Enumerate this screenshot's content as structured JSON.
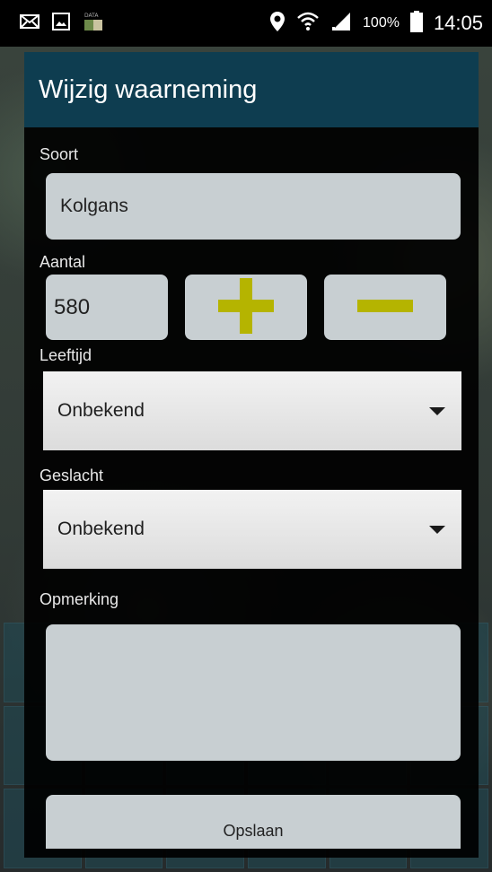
{
  "status_bar": {
    "battery": "100%",
    "time": "14:05",
    "icons": [
      "mail-icon",
      "image-icon",
      "data-icon",
      "location-icon",
      "wifi-icon",
      "signal-icon",
      "battery-icon"
    ]
  },
  "dialog": {
    "title": "Wijzig waarneming",
    "soort": {
      "label": "Soort",
      "value": "Kolgans"
    },
    "aantal": {
      "label": "Aantal",
      "value": "580",
      "plus_icon": "plus-icon",
      "minus_icon": "minus-icon"
    },
    "leeftijd": {
      "label": "Leeftijd",
      "selected": "Onbekend"
    },
    "geslacht": {
      "label": "Geslacht",
      "selected": "Onbekend"
    },
    "opmerking": {
      "label": "Opmerking",
      "value": ""
    },
    "save_label": "Opslaan"
  },
  "colors": {
    "header": "#0e3d50",
    "field": "#c8cfd2",
    "accent": "#b5b400"
  }
}
